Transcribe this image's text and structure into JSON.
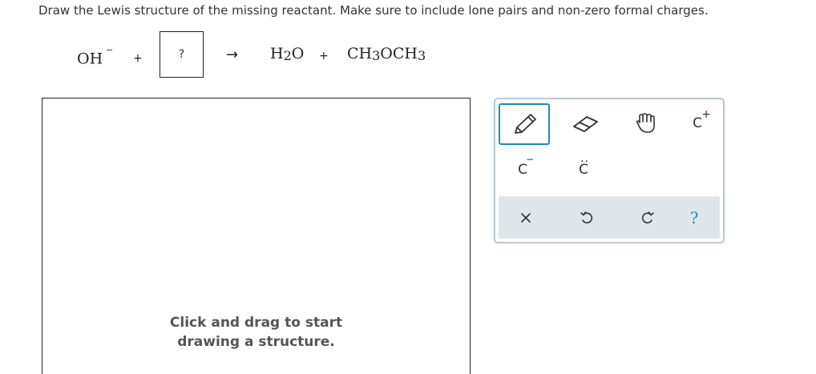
{
  "prompt": "Draw the Lewis structure of the missing reactant. Make sure to include lone pairs and non-zero formal charges.",
  "equation": {
    "reactant1": "OH",
    "reactant1_charge": "−",
    "plus": "+",
    "missing_box": "?",
    "arrow": "→",
    "product1_a": "H",
    "product1_sub": "2",
    "product1_b": "O",
    "product2_a": "CH",
    "product2_sub1": "3",
    "product2_b": "OCH",
    "product2_sub2": "3"
  },
  "canvas": {
    "hint_line1": "Click and drag to start",
    "hint_line2": "drawing a structure."
  },
  "toolbox": {
    "tools": [
      {
        "name": "pencil-icon"
      },
      {
        "name": "eraser-icon"
      },
      {
        "name": "hand-icon"
      },
      {
        "name": "positive-charge-icon",
        "label": "C",
        "mark": "+"
      },
      {
        "name": "negative-charge-icon",
        "label": "C",
        "mark": "−"
      },
      {
        "name": "lone-pair-icon",
        "label": "C",
        "mark": ":"
      }
    ],
    "actions": [
      {
        "name": "clear-icon"
      },
      {
        "name": "undo-icon"
      },
      {
        "name": "redo-icon"
      },
      {
        "name": "help-icon",
        "label": "?"
      }
    ],
    "colors": {
      "accent": "#1a8fb8",
      "border": "#b8c9d6",
      "action_bar": "#dfe6ea"
    }
  }
}
